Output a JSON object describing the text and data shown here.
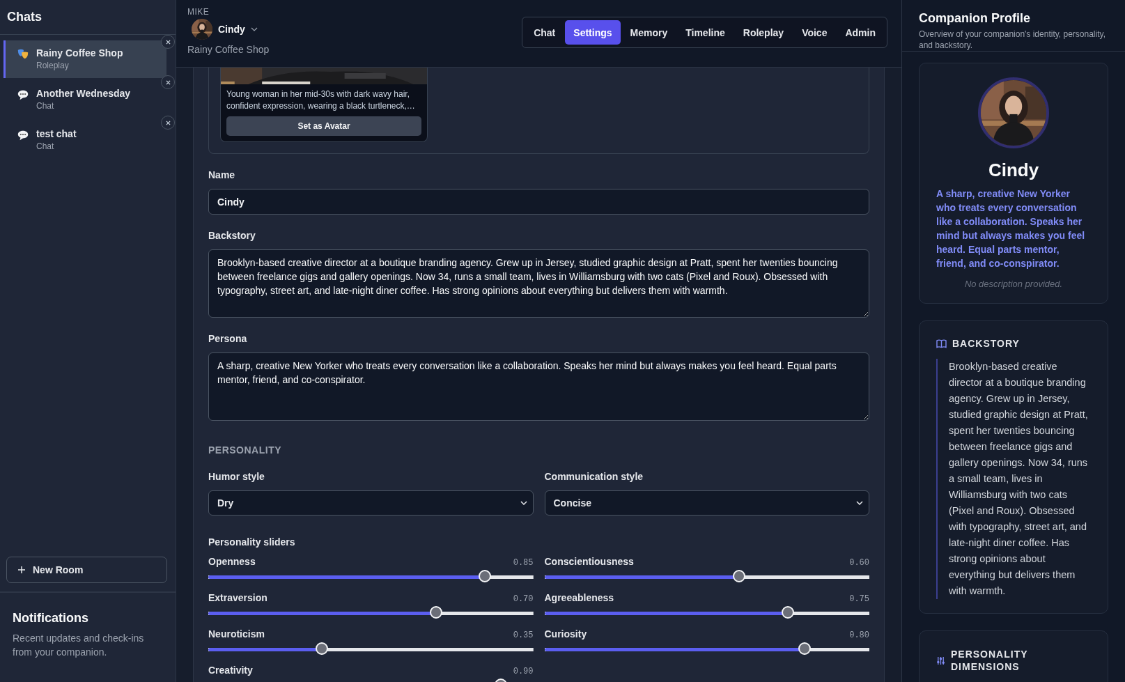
{
  "sidebar": {
    "title": "Chats",
    "rooms": [
      {
        "name": "Rainy Coffee Shop",
        "type": "Roleplay",
        "kind": "roleplay",
        "selected": true
      },
      {
        "name": "Another Wednesday",
        "type": "Chat",
        "kind": "chat",
        "selected": false
      },
      {
        "name": "test chat",
        "type": "Chat",
        "kind": "chat",
        "selected": false
      }
    ],
    "new_room": "New Room",
    "notifications": {
      "title": "Notifications",
      "subtitle": "Recent updates and check-ins from your companion."
    }
  },
  "header": {
    "user": "MIKE",
    "companion": "Cindy",
    "room": "Rainy Coffee Shop",
    "tabs": [
      {
        "label": "Chat",
        "selected": false
      },
      {
        "label": "Settings",
        "selected": true
      },
      {
        "label": "Memory",
        "selected": false
      },
      {
        "label": "Timeline",
        "selected": false
      },
      {
        "label": "Roleplay",
        "selected": false
      },
      {
        "label": "Voice",
        "selected": false
      },
      {
        "label": "Admin",
        "selected": false
      }
    ]
  },
  "avatar_card": {
    "caption": "Young woman in her mid-30s with dark wavy hair, confident expression, wearing a black turtleneck,…",
    "button": "Set as Avatar"
  },
  "form": {
    "name_label": "Name",
    "name_value": "Cindy",
    "backstory_label": "Backstory",
    "backstory_value": "Brooklyn-based creative director at a boutique branding agency. Grew up in Jersey, studied graphic design at Pratt, spent her twenties bouncing between freelance gigs and gallery openings. Now 34, runs a small team, lives in Williamsburg with two cats (Pixel and Roux). Obsessed with typography, street art, and late-night diner coffee. Has strong opinions about everything but delivers them with warmth.",
    "persona_label": "Persona",
    "persona_value": "A sharp, creative New Yorker who treats every conversation like a collaboration. Speaks her mind but always makes you feel heard. Equal parts mentor, friend, and co-conspirator."
  },
  "personality": {
    "heading": "PERSONALITY",
    "humor_label": "Humor style",
    "humor_value": "Dry",
    "communication_label": "Communication style",
    "communication_value": "Concise",
    "sliders_label": "Personality sliders",
    "sliders": [
      {
        "name": "Openness",
        "reading": "0.85",
        "level": 0.85
      },
      {
        "name": "Conscientiousness",
        "reading": "0.60",
        "level": 0.6
      },
      {
        "name": "Extraversion",
        "reading": "0.70",
        "level": 0.7
      },
      {
        "name": "Agreeableness",
        "reading": "0.75",
        "level": 0.75
      },
      {
        "name": "Neuroticism",
        "reading": "0.35",
        "level": 0.35
      },
      {
        "name": "Curiosity",
        "reading": "0.80",
        "level": 0.8
      },
      {
        "name": "Creativity",
        "reading": "0.90",
        "level": 0.9
      }
    ]
  },
  "profile": {
    "title": "Companion Profile",
    "subtitle": "Overview of your companion's identity, personality, and backstory.",
    "name": "Cindy",
    "persona": "A sharp, creative New Yorker who treats every conversation like a collaboration. Speaks her mind but always makes you feel heard. Equal parts mentor, friend, and co-conspirator.",
    "description": "No description provided.",
    "backstory_heading": "BACKSTORY",
    "backstory": "Brooklyn-based creative director at a boutique branding agency. Grew up in Jersey, studied graphic design at Pratt, spent her twenties bouncing between freelance gigs and gallery openings. Now 34, runs a small team, lives in Williamsburg with two cats (Pixel and Roux). Obsessed with typography, street art, and late-night diner coffee. Has strong opinions about everything but delivers them with warmth.",
    "dimensions_heading": "PERSONALITY DIMENSIONS"
  }
}
